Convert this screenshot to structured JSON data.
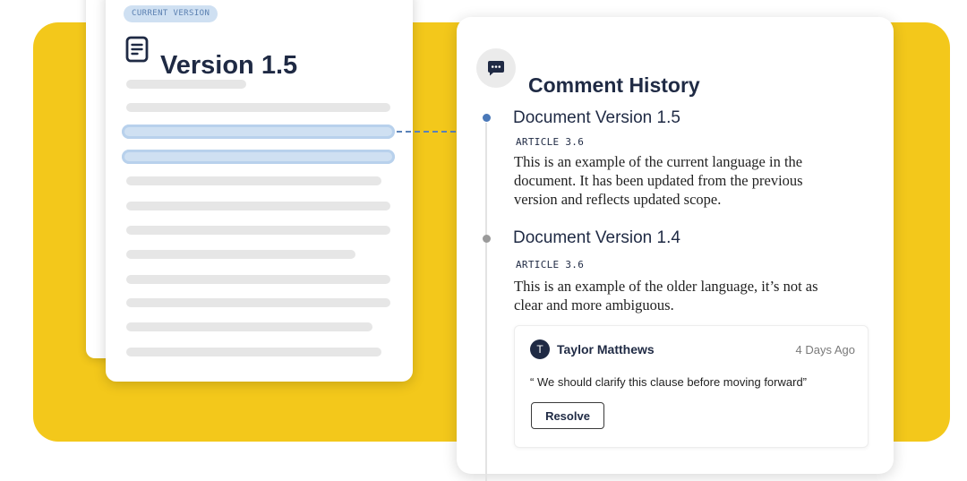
{
  "document": {
    "badge": "CURRENT VERSION",
    "title": "Version 1.5",
    "icon": "document-icon"
  },
  "history": {
    "title": "Comment History",
    "icon": "comment-icon",
    "entries": [
      {
        "title": "Document Version 1.5",
        "article": "ARTICLE 3.6",
        "body": "This is an example of the current language in the document. It has been updated from the previous version and reflects updated scope.",
        "status": "current"
      },
      {
        "title": "Document Version 1.4",
        "article": "ARTICLE 3.6",
        "body": "This is an example of the older language, it’s not as clear and more ambiguous.",
        "status": "previous"
      }
    ],
    "comment": {
      "avatar_initial": "T",
      "author": "Taylor Matthews",
      "time": "4 Days Ago",
      "text": "“ We should clarify this clause before moving forward”",
      "resolve_label": "Resolve"
    }
  },
  "colors": {
    "backdrop": "#f3c81b",
    "accent_blue": "#4a78b8",
    "text_dark": "#1f2a44",
    "highlight": "#cfe0f2"
  }
}
